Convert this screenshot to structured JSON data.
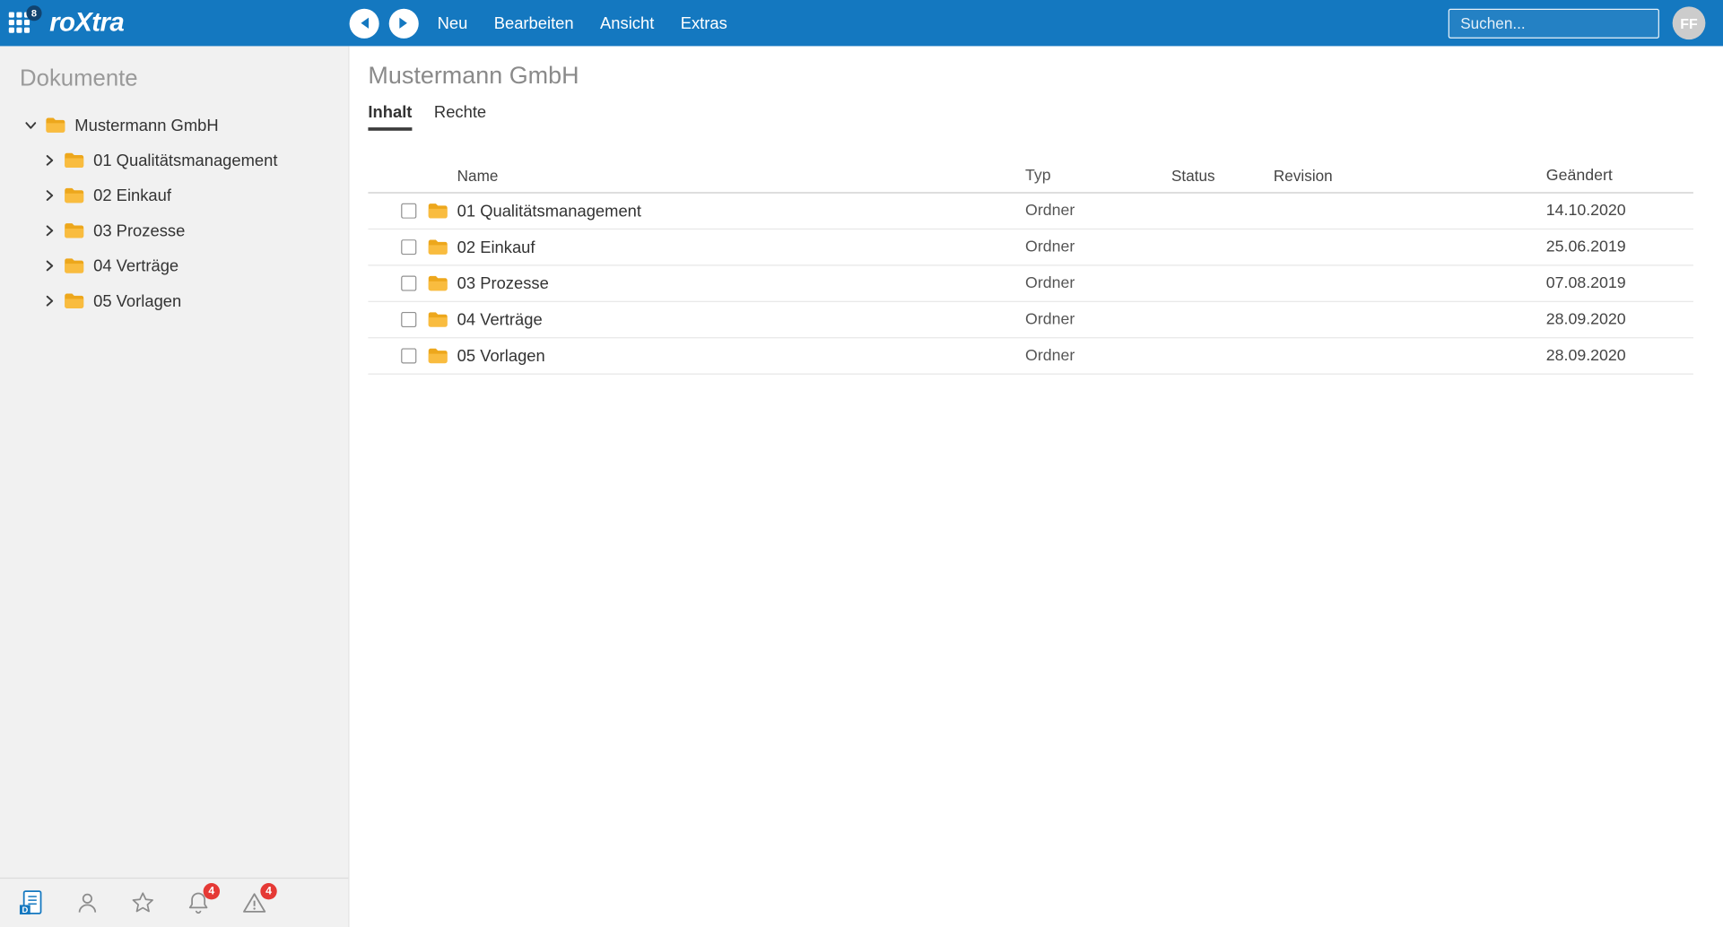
{
  "colors": {
    "accent_blue": "#1478c0",
    "folder_yellow": "#f7b021",
    "badge_red": "#e53935",
    "apps_badge_navy": "#11436f"
  },
  "topbar": {
    "logo": "roXtra",
    "apps_badge": "8",
    "menu": [
      "Neu",
      "Bearbeiten",
      "Ansicht",
      "Extras"
    ],
    "search_placeholder": "Suchen...",
    "avatar_initials": "FF"
  },
  "sidebar": {
    "title": "Dokumente",
    "tree": [
      {
        "label": "Mustermann GmbH",
        "level": 0,
        "expanded": true
      },
      {
        "label": "01 Qualitätsmanagement",
        "level": 1,
        "expanded": false
      },
      {
        "label": "02 Einkauf",
        "level": 1,
        "expanded": false
      },
      {
        "label": "03 Prozesse",
        "level": 1,
        "expanded": false
      },
      {
        "label": "04 Verträge",
        "level": 1,
        "expanded": false
      },
      {
        "label": "05 Vorlagen",
        "level": 1,
        "expanded": false
      }
    ],
    "footer": {
      "notifications_badge": "4",
      "warnings_badge": "4"
    }
  },
  "main": {
    "title": "Mustermann GmbH",
    "tabs": [
      {
        "label": "Inhalt",
        "active": true
      },
      {
        "label": "Rechte",
        "active": false
      }
    ],
    "table": {
      "columns": [
        "Name",
        "Typ",
        "Status",
        "Revision",
        "Geändert"
      ],
      "rows": [
        {
          "name": "01 Qualitätsmanagement",
          "typ": "Ordner",
          "status": "",
          "revision": "",
          "geaendert": "14.10.2020"
        },
        {
          "name": "02 Einkauf",
          "typ": "Ordner",
          "status": "",
          "revision": "",
          "geaendert": "25.06.2019"
        },
        {
          "name": "03 Prozesse",
          "typ": "Ordner",
          "status": "",
          "revision": "",
          "geaendert": "07.08.2019"
        },
        {
          "name": "04 Verträge",
          "typ": "Ordner",
          "status": "",
          "revision": "",
          "geaendert": "28.09.2020"
        },
        {
          "name": "05 Vorlagen",
          "typ": "Ordner",
          "status": "",
          "revision": "",
          "geaendert": "28.09.2020"
        }
      ]
    }
  }
}
